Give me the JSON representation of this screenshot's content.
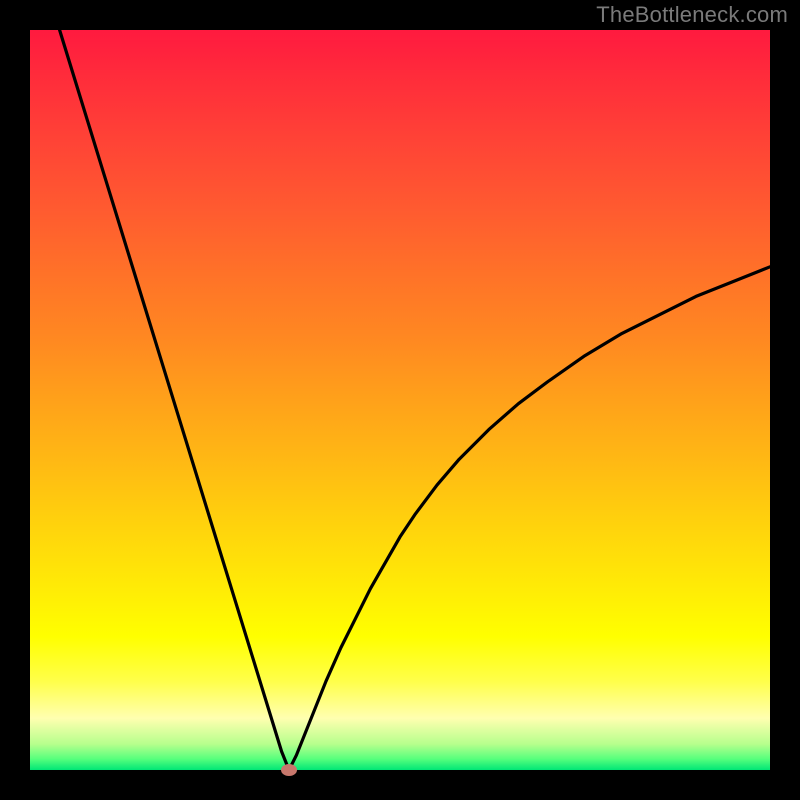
{
  "watermark": "TheBottleneck.com",
  "chart_data": {
    "type": "line",
    "title": "",
    "xlabel": "",
    "ylabel": "",
    "xlim": [
      0,
      100
    ],
    "ylim": [
      0,
      100
    ],
    "grid": false,
    "legend": false,
    "series": [
      {
        "name": "bottleneck-curve",
        "x": [
          4,
          6,
          8,
          10,
          12,
          14,
          16,
          18,
          20,
          22,
          24,
          26,
          28,
          30,
          32,
          34,
          35,
          36,
          38,
          40,
          42,
          44,
          46,
          48,
          50,
          52,
          55,
          58,
          62,
          66,
          70,
          75,
          80,
          85,
          90,
          95,
          100
        ],
        "values": [
          100,
          93.5,
          87,
          80.5,
          74,
          67.5,
          61,
          54.5,
          48,
          41.5,
          35,
          28.5,
          22,
          15.5,
          9,
          2.5,
          0,
          2,
          7,
          12,
          16.5,
          20.5,
          24.5,
          28,
          31.5,
          34.5,
          38.5,
          42,
          46,
          49.5,
          52.5,
          56,
          59,
          61.5,
          64,
          66,
          68
        ]
      }
    ],
    "annotations": [
      {
        "name": "optimum-marker",
        "x": 35,
        "y": 0,
        "color": "#c7776c"
      }
    ],
    "background_gradient": {
      "top": "#ff1a3f",
      "mid": "#ffff00",
      "bottom": "#00e676"
    }
  }
}
